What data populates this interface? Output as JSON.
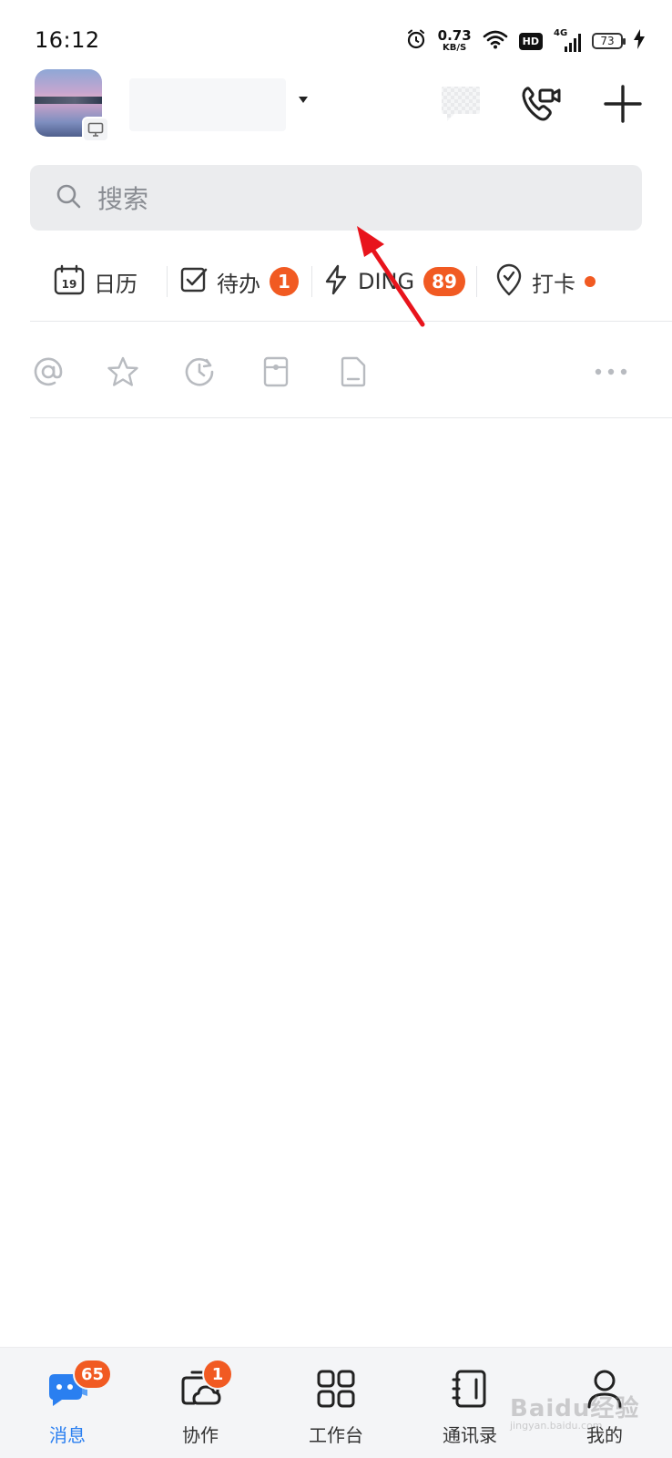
{
  "status_bar": {
    "time": "16:12",
    "net_speed_value": "0.73",
    "net_speed_unit": "KB/S",
    "hd_label": "HD",
    "network_label": "4G",
    "battery_level": "73",
    "icons": [
      "alarm-icon",
      "wifi-icon",
      "signal-icon",
      "battery-icon",
      "charging-icon"
    ]
  },
  "header": {
    "icons": [
      "avatar",
      "monitor-icon",
      "chevron-down-icon",
      "chat-bubble-icon",
      "video-call-icon",
      "plus-icon"
    ]
  },
  "search": {
    "placeholder": "搜索"
  },
  "quick_actions": {
    "calendar": {
      "label": "日历",
      "day": "19"
    },
    "todo": {
      "label": "待办",
      "badge": "1"
    },
    "ding": {
      "label": "DING",
      "badge": "89"
    },
    "checkin": {
      "label": "打卡"
    }
  },
  "filter_icons": [
    "at-icon",
    "star-icon",
    "clock-icon",
    "tag-icon",
    "document-icon",
    "more-icon"
  ],
  "bottom_nav": {
    "messages": {
      "label": "消息",
      "badge": "65"
    },
    "collab": {
      "label": "协作",
      "badge": "1"
    },
    "workbench": {
      "label": "工作台"
    },
    "contacts": {
      "label": "通讯录"
    },
    "mine": {
      "label": "我的"
    }
  },
  "watermark": {
    "text": "Baidu经验",
    "sub": "jingyan.baidu.com"
  },
  "colors": {
    "accent_blue": "#2a7ff0",
    "badge_orange": "#f15a22",
    "annotation_red": "#e8141c",
    "search_bg": "#ebecee"
  }
}
